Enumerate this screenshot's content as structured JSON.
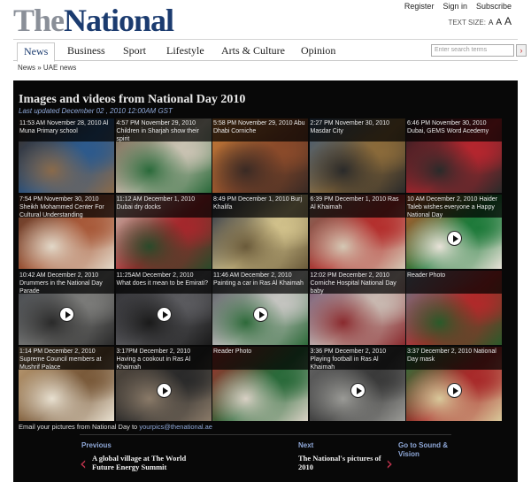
{
  "header": {
    "logo_the": "The",
    "logo_national": "National",
    "links": [
      "Register",
      "Sign in",
      "Subscribe"
    ],
    "text_size_label": "TEXT SIZE:",
    "text_size_options": [
      "A",
      "A",
      "A"
    ]
  },
  "nav": {
    "items": [
      "News",
      "Business",
      "Sport",
      "Lifestyle",
      "Arts & Culture",
      "Opinion"
    ],
    "active": "News",
    "search_placeholder": "Enter search terms"
  },
  "breadcrumb": {
    "text": "News » UAE news"
  },
  "gallery": {
    "title": "Images and videos from National Day 2010",
    "updated": "Last updated December 02 , 2010 12:00AM GST",
    "email_prefix": "Email your pictures from National Day to",
    "email_address": "yourpics@thenational.ae",
    "tiles": [
      {
        "caption": "11:53 AM   November 28, 2010   Al Muna Primary school",
        "video": false,
        "colors": [
          "#3a2a1e",
          "#2d5a8c",
          "#8a6a4a"
        ]
      },
      {
        "caption": "4:57 PM   November 29, 2010   Children in Sharjah show their spirit",
        "video": false,
        "colors": [
          "#6a5a44",
          "#c9c2b2",
          "#2a6a3a"
        ]
      },
      {
        "caption": "5:58 PM   November 29, 2010   Abu Dhabi Corniche",
        "video": false,
        "colors": [
          "#c9803a",
          "#8a4a2a",
          "#3a2a24"
        ]
      },
      {
        "caption": "2:27 PM   November 30, 2010   Masdar City",
        "video": false,
        "colors": [
          "#3e5a7a",
          "#8a6a3a",
          "#2a2a2a"
        ]
      },
      {
        "caption": "6:46 PM   November 30, 2010   Dubai, GEMS Word Acedemy",
        "video": false,
        "colors": [
          "#1e1e22",
          "#b4262e",
          "#2a2a2a"
        ]
      },
      {
        "caption": "7:54 PM   November 30, 2010   Sheikh Mohammed Center For Cultural Understanding",
        "video": false,
        "colors": [
          "#5a3626",
          "#a85a3a",
          "#e2d8c8"
        ]
      },
      {
        "caption": "11:12 AM   December 1, 2010   Dubai dry docks",
        "video": false,
        "colors": [
          "#c8c2b4",
          "#a4282c",
          "#2a4a2a"
        ]
      },
      {
        "caption": "8:49 PM   December 1, 2010   Burj Khalifa",
        "video": false,
        "colors": [
          "#1a2238",
          "#d0c08a",
          "#6a5a3a"
        ]
      },
      {
        "caption": "6:39 PM   December 1, 2010   Ras Al Khaimah",
        "video": false,
        "colors": [
          "#7a6a5a",
          "#b4302e",
          "#d4c8b4"
        ]
      },
      {
        "caption": "10 AM   December 2, 2010   Haider Taleb wishes everyone a Happy National Day",
        "video": true,
        "colors": [
          "#c4542a",
          "#1e7a3a",
          "#e8e2d8"
        ]
      },
      {
        "caption": "10:42 AM   December 2, 2010   Drummers in the National Day Parade",
        "video": true,
        "colors": [
          "#3a3e44",
          "#7a7a78",
          "#2a2a2a"
        ]
      },
      {
        "caption": "11:25AM   December 2, 2010   What does it mean to be Emirati?",
        "video": true,
        "colors": [
          "#2a2a2e",
          "#5a5a5e",
          "#1a1a1a"
        ]
      },
      {
        "caption": "11:46 AM   December 2, 2010   Painting a car in Ras Al Khaimah",
        "video": true,
        "colors": [
          "#4a4e56",
          "#c4c4c0",
          "#2e6a3a"
        ]
      },
      {
        "caption": "12:02 PM   December 2, 2010   Corniche Hospital National Day baby",
        "video": false,
        "colors": [
          "#6a4a6a",
          "#c8b8b0",
          "#8a2a2e"
        ]
      },
      {
        "caption": "Reader Photo",
        "video": false,
        "colors": [
          "#6a7a8a",
          "#b02a2a",
          "#2a5a2a"
        ]
      },
      {
        "caption": "1:14 PM   December 2, 2010   Supreme Council members at Mushrif Palace",
        "video": false,
        "colors": [
          "#c4a47a",
          "#7a5a3a",
          "#e8e0d0"
        ]
      },
      {
        "caption": "3:17PM   December 2, 2010   Having a cookout in Ras Al Khaimah",
        "video": true,
        "colors": [
          "#5a4e42",
          "#2a2a2a",
          "#8a7a68"
        ]
      },
      {
        "caption": "Reader Photo",
        "video": false,
        "colors": [
          "#a82a2a",
          "#2a6a3a",
          "#d8d0c4"
        ]
      },
      {
        "caption": "3:36 PM   December 2, 2010   Playing football in Ras Al Khaimah",
        "video": true,
        "colors": [
          "#6a6a6a",
          "#3a3a3a",
          "#9a9a96"
        ]
      },
      {
        "caption": "3:37   December 2, 2010   National Day mask",
        "video": true,
        "colors": [
          "#1e7a3a",
          "#a82a2a",
          "#d8c89a"
        ]
      }
    ]
  },
  "pager": {
    "prev_label": "Previous",
    "prev_title": "A global village at The World Future Energy Summit",
    "next_label": "Next",
    "next_title": "The National's pictures of 2010",
    "goto": "Go to Sound & Vision"
  }
}
